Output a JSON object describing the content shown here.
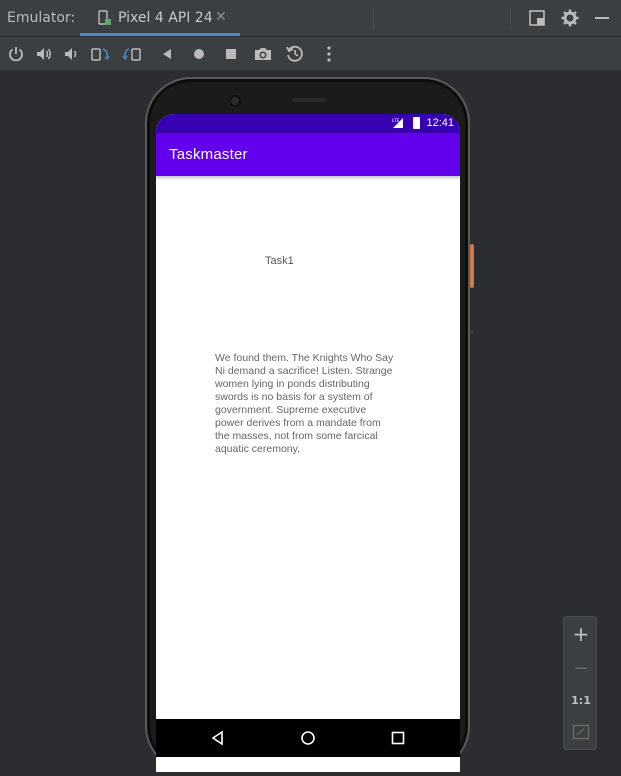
{
  "window": {
    "label": "Emulator:",
    "tab": {
      "title": "Pixel 4 API 24",
      "close": "✕"
    }
  },
  "toolbar": {
    "buttons": [
      "power-icon",
      "volume-up-icon",
      "volume-down-icon",
      "rotate-left-icon",
      "rotate-right-icon",
      "back-icon",
      "home-icon",
      "overview-icon",
      "camera-icon",
      "snapshot-icon",
      "more-icon"
    ]
  },
  "device": {
    "status_bar": {
      "network": "LTE",
      "time": "12:41"
    },
    "app_bar": {
      "title": "Taskmaster"
    },
    "content": {
      "task_title": "Task1",
      "task_body": "We found them. The Knights Who Say Ni demand a sacrifice! Listen. Strange women lying in ponds distributing swords is no basis for a system of government. Supreme executive power derives from a mandate from the masses, not from some farcical aquatic ceremony."
    },
    "colors": {
      "status_bar": "#3700b3",
      "app_bar": "#6200ee"
    }
  },
  "zoom_controls": {
    "zoom_in": "+",
    "zoom_out": "−",
    "actual_size": "1:1"
  }
}
